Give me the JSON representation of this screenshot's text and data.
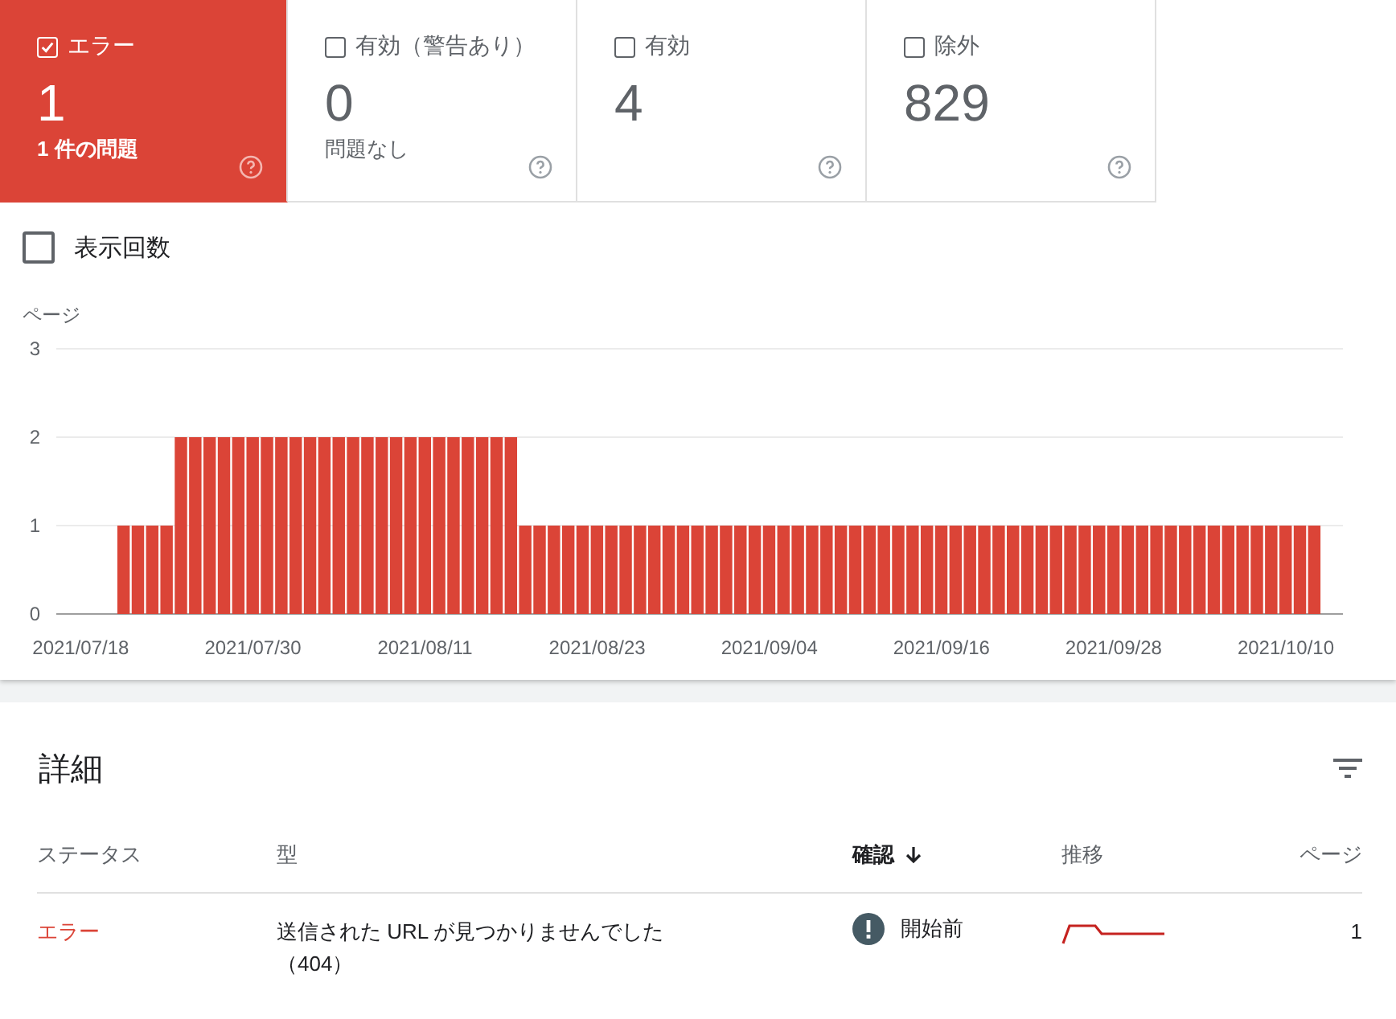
{
  "cards": [
    {
      "label": "エラー",
      "value": "1",
      "subtitle": "1 件の問題",
      "selected": true,
      "checked": true
    },
    {
      "label": "有効（警告あり）",
      "value": "0",
      "subtitle": "問題なし",
      "selected": false,
      "checked": false
    },
    {
      "label": "有効",
      "value": "4",
      "selected": false,
      "checked": false
    },
    {
      "label": "除外",
      "value": "829",
      "selected": false,
      "checked": false
    }
  ],
  "impressions": {
    "label": "表示回数",
    "checked": false
  },
  "chart": {
    "chart_data": {
      "type": "bar",
      "ylabel": "ページ",
      "yticks": [
        0,
        1,
        2,
        3
      ],
      "ylim": [
        0,
        3
      ],
      "categories": [
        "2021/07/18",
        null,
        null,
        null,
        null,
        null,
        null,
        null,
        null,
        null,
        null,
        null,
        "2021/07/30",
        null,
        null,
        null,
        null,
        null,
        null,
        null,
        null,
        null,
        null,
        null,
        "2021/08/11",
        null,
        null,
        null,
        null,
        null,
        null,
        null,
        null,
        null,
        null,
        null,
        "2021/08/23",
        null,
        null,
        null,
        null,
        null,
        null,
        null,
        null,
        null,
        null,
        null,
        "2021/09/04",
        null,
        null,
        null,
        null,
        null,
        null,
        null,
        null,
        null,
        null,
        null,
        "2021/09/16",
        null,
        null,
        null,
        null,
        null,
        null,
        null,
        null,
        null,
        null,
        null,
        "2021/09/28",
        null,
        null,
        null,
        null,
        null,
        null,
        null,
        null,
        null,
        null,
        null,
        "2021/10/10",
        null,
        null
      ],
      "series": [
        {
          "color": "#db4437",
          "values": [
            null,
            null,
            null,
            1,
            1,
            1,
            1,
            2,
            2,
            2,
            2,
            2,
            2,
            2,
            2,
            2,
            2,
            2,
            2,
            2,
            2,
            2,
            2,
            2,
            2,
            2,
            2,
            2,
            2,
            2,
            2,
            1,
            1,
            1,
            1,
            1,
            1,
            1,
            1,
            1,
            1,
            1,
            1,
            1,
            1,
            1,
            1,
            1,
            1,
            1,
            1,
            1,
            1,
            1,
            1,
            1,
            1,
            1,
            1,
            1,
            1,
            1,
            1,
            1,
            1,
            1,
            1,
            1,
            1,
            1,
            1,
            1,
            1,
            1,
            1,
            1,
            1,
            1,
            1,
            1,
            1,
            1,
            1,
            1,
            1,
            1,
            1
          ]
        }
      ]
    }
  },
  "details": {
    "title": "詳細",
    "columns": [
      {
        "label": "ステータス",
        "sorted": false
      },
      {
        "label": "型",
        "sorted": false
      },
      {
        "label": "確認",
        "sorted": true
      },
      {
        "label": "推移",
        "sorted": false
      },
      {
        "label": "ページ",
        "sorted": false
      }
    ],
    "rows": [
      {
        "status": "エラー",
        "type": "送信された URL が見つかりませんでした（404）",
        "validation": "開始前",
        "pages": "1"
      }
    ]
  }
}
